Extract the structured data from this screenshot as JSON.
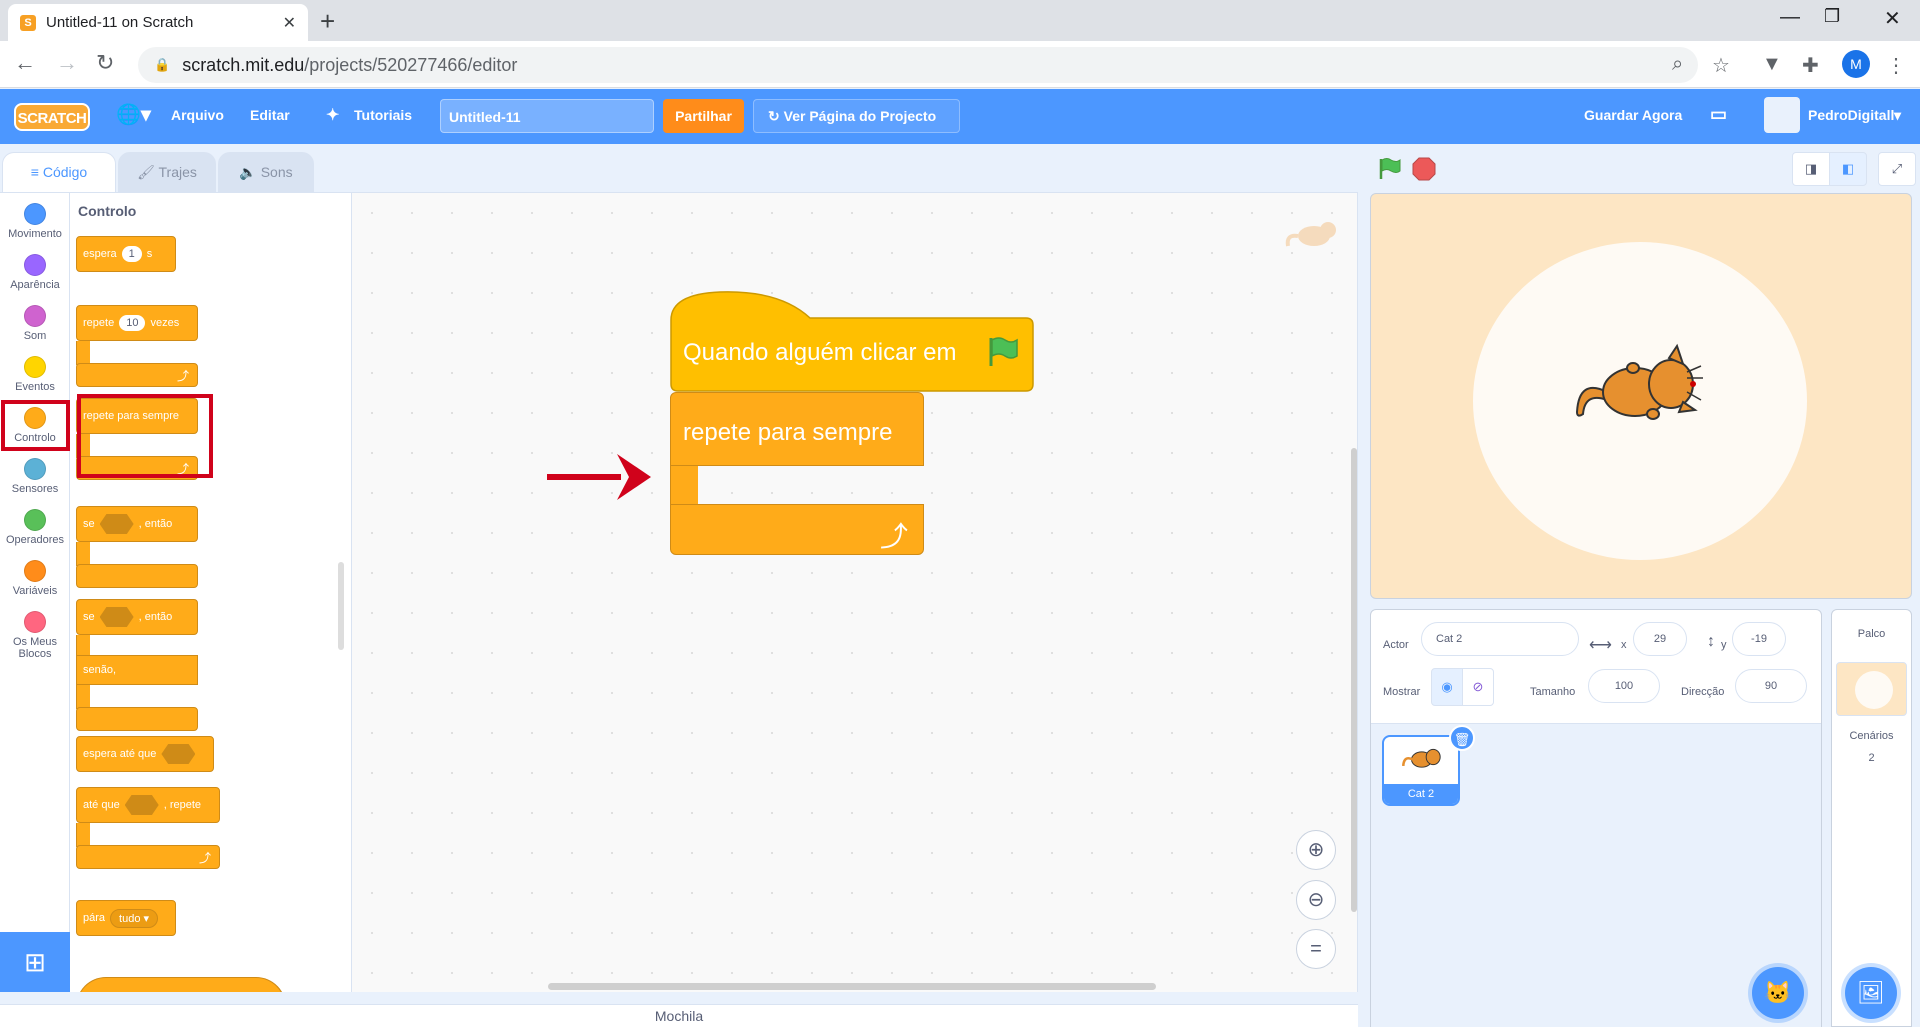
{
  "browser": {
    "tab_title": "Untitled-11 on Scratch",
    "favicon": "S",
    "url_host": "scratch.mit.edu",
    "url_path": "/projects/520277466/editor",
    "profile_initial": "M"
  },
  "menu": {
    "logo": "SCRATCH",
    "file": "Arquivo",
    "edit": "Editar",
    "tutorials": "Tutoriais",
    "project_title": "Untitled-11",
    "share": "Partilhar",
    "see_project": "Ver Página do Projecto",
    "save_now": "Guardar Agora",
    "username": "PedroDigitall"
  },
  "editor_tabs": {
    "code": "Código",
    "costumes": "Trajes",
    "sounds": "Sons"
  },
  "categories": [
    {
      "label": "Movimento",
      "color": "#4c97ff"
    },
    {
      "label": "Aparência",
      "color": "#9966ff"
    },
    {
      "label": "Som",
      "color": "#cf63cf"
    },
    {
      "label": "Eventos",
      "color": "#ffd500"
    },
    {
      "label": "Controlo",
      "color": "#ffab19"
    },
    {
      "label": "Sensores",
      "color": "#5cb1d6"
    },
    {
      "label": "Operadores",
      "color": "#59c059"
    },
    {
      "label": "Variáveis",
      "color": "#ff8c1a"
    },
    {
      "label": "Os Meus Blocos",
      "color": "#ff6680"
    }
  ],
  "palette": {
    "title": "Controlo",
    "wait_label": "espera",
    "wait_value": "1",
    "wait_unit": "s",
    "repeat_label": "repete",
    "repeat_value": "10",
    "repeat_unit": "vezes",
    "forever_label": "repete para sempre",
    "if_label": "se",
    "then_label": ", então",
    "else_label": "senão,",
    "wait_until_label": "espera até que",
    "until_label": "até que",
    "until_repeat": ", repete",
    "stop_label": "pára",
    "stop_option": "tudo"
  },
  "script": {
    "hat_label": "Quando alguém clicar em",
    "forever_label": "repete para sempre"
  },
  "sprite_info": {
    "sprite_label": "Actor",
    "sprite_name": "Cat 2",
    "x_label": "x",
    "x_value": "29",
    "y_label": "y",
    "y_value": "-19",
    "show_label": "Mostrar",
    "size_label": "Tamanho",
    "size_value": "100",
    "direction_label": "Direcção",
    "direction_value": "90"
  },
  "sprites": [
    {
      "name": "Cat 2"
    }
  ],
  "stage_pane": {
    "title": "Palco",
    "backdrops_label": "Cenários",
    "backdrops_count": "2"
  },
  "backpack": "Mochila"
}
